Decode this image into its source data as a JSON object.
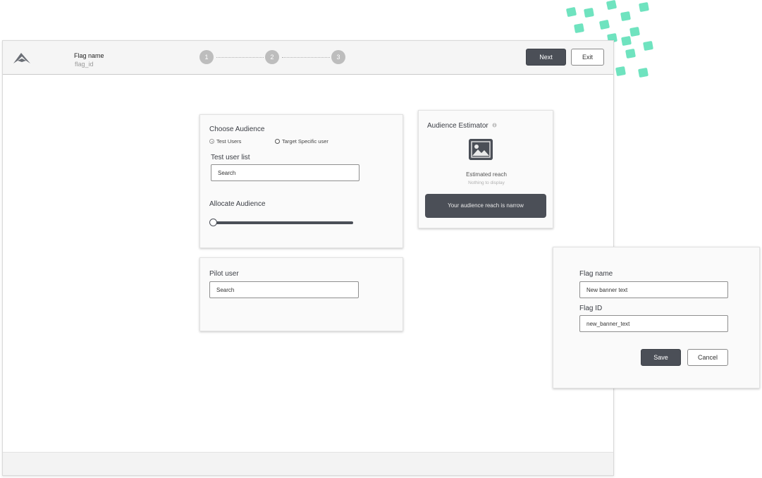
{
  "header": {
    "flag_title": "Flag name",
    "flag_id": "flag_id",
    "steps": [
      "1",
      "2",
      "3"
    ],
    "next_label": "Next",
    "exit_label": "Exit"
  },
  "choose_audience": {
    "title": "Choose Audience",
    "options": [
      {
        "label": "Test Users",
        "selected": true
      },
      {
        "label": "Target Specific user",
        "selected": false
      }
    ],
    "test_user_list_label": "Test user list",
    "search_value": "Search",
    "allocate_label": "Allocate Audience",
    "allocation_fraction": 0.0
  },
  "pilot_user": {
    "title": "Pilot user",
    "search_value": "Search"
  },
  "estimator": {
    "title": "Audience Estimator",
    "info_icon": "info-icon",
    "image_icon": "image-icon",
    "reach_label": "Estimated reach",
    "reach_value": "Nothing to display",
    "banner_text": "Your audience reach is narrow"
  },
  "flag_form": {
    "name_label": "Flag name",
    "name_value": "New banner text",
    "id_label": "Flag ID",
    "id_value": "new_banner_text",
    "save_label": "Save",
    "cancel_label": "Cancel"
  },
  "colors": {
    "accent_dots": "#6fe3bf",
    "primary_button": "#4b4f57"
  }
}
